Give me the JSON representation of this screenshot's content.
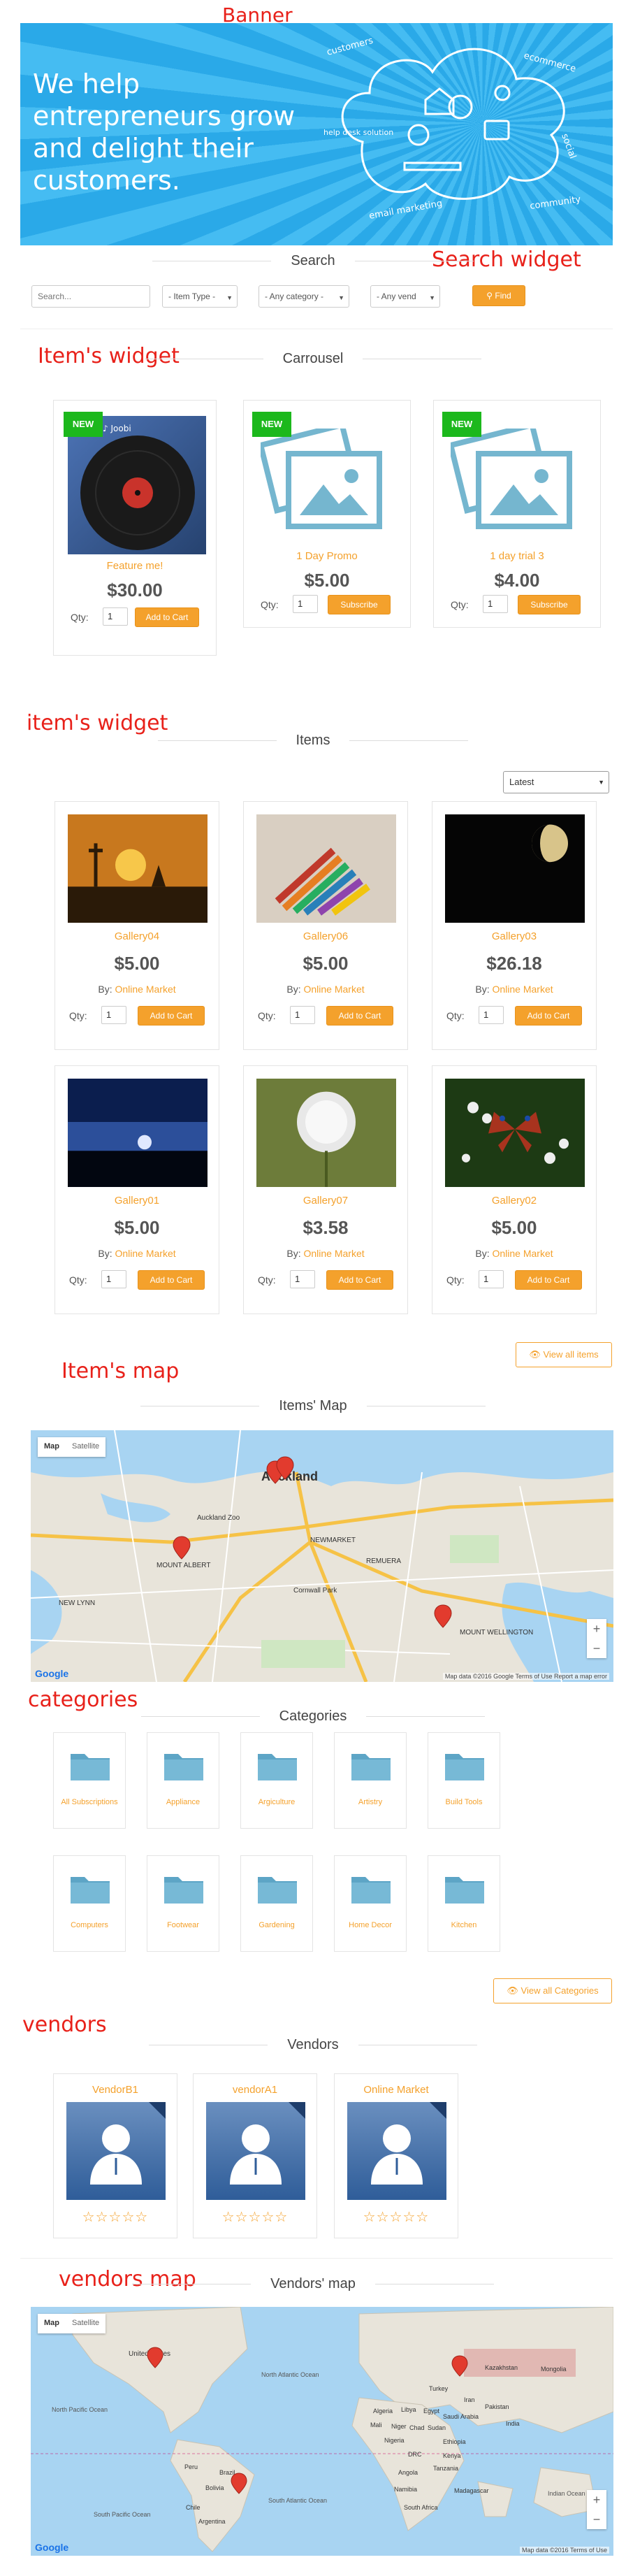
{
  "annotations": {
    "banner": "Banner",
    "search_widget": "Search widget",
    "items_widget_1": "Item's widget",
    "items_widget_2": "item's widget",
    "items_map": "Item's map",
    "categories": "categories",
    "vendors": "vendors",
    "vendors_map": "vendors map"
  },
  "banner": {
    "headline": "We help entrepreneurs grow and delight their customers.",
    "cloud_words": [
      "customers",
      "ecommerce",
      "help desk solution",
      "email marketing",
      "community",
      "social"
    ]
  },
  "search": {
    "title": "Search",
    "input_placeholder": "Search...",
    "item_type": "- Item Type -",
    "category": "- Any category -",
    "vendor": "- Any vend",
    "find_label": "Find",
    "find_icon": "search-icon"
  },
  "carousel": {
    "title": "Carrousel",
    "items": [
      {
        "badge": "NEW",
        "name": "Feature me!",
        "price": "$30.00",
        "qty_label": "Qty:",
        "qty": "1",
        "button": "Add to Cart",
        "image": "vinyl-record"
      },
      {
        "badge": "NEW",
        "name": "1 Day Promo",
        "price": "$5.00",
        "qty_label": "Qty:",
        "qty": "1",
        "button": "Subscribe",
        "image": "placeholder-photo"
      },
      {
        "badge": "NEW",
        "name": "1 day trial 3",
        "price": "$4.00",
        "qty_label": "Qty:",
        "qty": "1",
        "button": "Subscribe",
        "image": "placeholder-photo"
      }
    ]
  },
  "items": {
    "title": "Items",
    "sort_selected": "Latest",
    "by_label": "By:",
    "list": [
      {
        "name": "Gallery04",
        "price": "$5.00",
        "vendor": "Online Market",
        "qty_label": "Qty:",
        "qty": "1",
        "button": "Add to Cart",
        "image": "sunset-silhouette"
      },
      {
        "name": "Gallery06",
        "price": "$5.00",
        "vendor": "Online Market",
        "qty_label": "Qty:",
        "qty": "1",
        "button": "Add to Cart",
        "image": "colored-pencils"
      },
      {
        "name": "Gallery03",
        "price": "$26.18",
        "vendor": "Online Market",
        "qty_label": "Qty:",
        "qty": "1",
        "button": "Add to Cart",
        "image": "half-moon"
      },
      {
        "name": "Gallery01",
        "price": "$5.00",
        "vendor": "Online Market",
        "qty_label": "Qty:",
        "qty": "1",
        "button": "Add to Cart",
        "image": "night-sky"
      },
      {
        "name": "Gallery07",
        "price": "$3.58",
        "vendor": "Online Market",
        "qty_label": "Qty:",
        "qty": "1",
        "button": "Add to Cart",
        "image": "dandelion"
      },
      {
        "name": "Gallery02",
        "price": "$5.00",
        "vendor": "Online Market",
        "qty_label": "Qty:",
        "qty": "1",
        "button": "Add to Cart",
        "image": "butterfly-flowers"
      }
    ],
    "view_all": "View all items",
    "view_all_icon": "eye-icon"
  },
  "items_map": {
    "title": "Items' Map",
    "tab_map": "Map",
    "tab_satellite": "Satellite",
    "labels": [
      "Auckland",
      "Auckland Zoo",
      "MOUNT ALBERT",
      "NEWMARKET",
      "REMUERA",
      "NEW LYNN",
      "Cornwall Park",
      "MOUNT WELLINGTON"
    ],
    "attribution": "Map data ©2016 Google   Terms of Use   Report a map error",
    "google": "Google"
  },
  "categories": {
    "title": "Categories",
    "list": [
      "All Subscriptions",
      "Appliance",
      "Argiculture",
      "Artistry",
      "Build Tools",
      "Computers",
      "Footwear",
      "Gardening",
      "Home Decor",
      "Kitchen"
    ],
    "view_all": "View all Categories",
    "view_all_icon": "eye-icon"
  },
  "vendors": {
    "title": "Vendors",
    "list": [
      {
        "name": "VendorB1",
        "stars": "☆☆☆☆☆"
      },
      {
        "name": "vendorA1",
        "stars": "☆☆☆☆☆"
      },
      {
        "name": "Online Market",
        "stars": "☆☆☆☆☆"
      }
    ]
  },
  "vendors_map": {
    "title": "Vendors' map",
    "tab_map": "Map",
    "tab_satellite": "Satellite",
    "labels": [
      "United States",
      "North Atlantic Ocean",
      "North Pacific Ocean",
      "South Pacific Ocean",
      "South Atlantic Ocean",
      "Indian Ocean",
      "Brazil",
      "Peru",
      "Bolivia",
      "Argentina",
      "Chile",
      "Algeria",
      "Libya",
      "Egypt",
      "Mali",
      "Niger",
      "Chad",
      "Sudan",
      "Nigeria",
      "Ethiopia",
      "Kenya",
      "DRC",
      "Tanzania",
      "Angola",
      "Namibia",
      "South Africa",
      "Madagascar",
      "Turkey",
      "Iran",
      "Saudi Arabia",
      "Pakistan",
      "India",
      "Kazakhstan",
      "Mongolia"
    ],
    "attribution": "Map data ©2016   Terms of Use",
    "google": "Google"
  },
  "colors": {
    "accent": "#f4a12c",
    "badge_new": "#1cb81c",
    "banner_blue": "#2aa9e8",
    "annotation_red": "#e8211a",
    "folder_blue": "#6fb5d3"
  }
}
